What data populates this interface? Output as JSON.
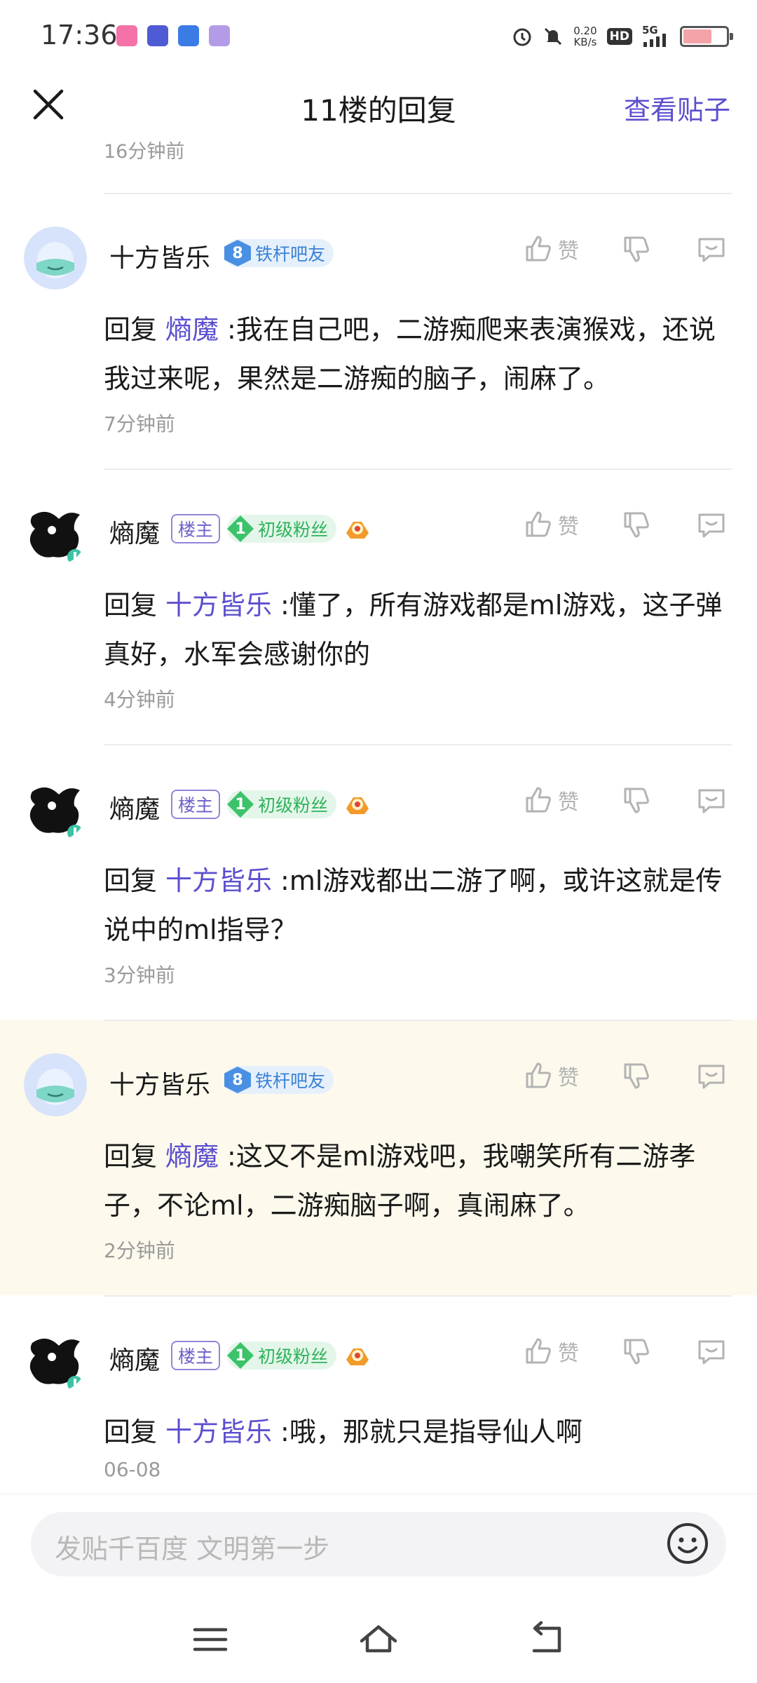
{
  "status_bar": {
    "time": "17:36",
    "net_speed_value": "0.20",
    "net_speed_unit": "KB/s",
    "hd": "HD",
    "signal": "5G",
    "icons": [
      "bilibili-app-icon",
      "tieba-app-icon",
      "tool-app-icon",
      "avatar-app-icon",
      "alarm-icon",
      "mute-icon",
      "signal-icon",
      "battery-icon"
    ]
  },
  "header": {
    "title": "11楼的回复",
    "view_post": "查看贴子"
  },
  "prev_reply_time": "16分钟前",
  "like_label": "赞",
  "reply_prefix": "回复",
  "replies": [
    {
      "user": "十方皆乐",
      "level": "8",
      "level_title": "铁杆吧友",
      "target": "熵魔",
      "text": ":我在自己吧，二游痴爬来表演猴戏，还说我过来呢，果然是二游痴的脑子，闹麻了。",
      "time": "7分钟前"
    },
    {
      "user": "熵魔",
      "owner_tag": "楼主",
      "level": "1",
      "level_title": "初级粉丝",
      "target": "十方皆乐",
      "text": ":懂了，所有游戏都是ml游戏，这子弹真好，水军会感谢你的",
      "time": "4分钟前"
    },
    {
      "user": "熵魔",
      "owner_tag": "楼主",
      "level": "1",
      "level_title": "初级粉丝",
      "target": "十方皆乐",
      "text": ":ml游戏都出二游了啊，或许这就是传说中的ml指导？",
      "time": "3分钟前"
    },
    {
      "user": "十方皆乐",
      "level": "8",
      "level_title": "铁杆吧友",
      "target": "熵魔",
      "text": ":这又不是ml游戏吧，我嘲笑所有二游孝子，不论ml，二游痴脑子啊，真闹麻了。",
      "time": "2分钟前"
    },
    {
      "user": "熵魔",
      "owner_tag": "楼主",
      "level": "1",
      "level_title": "初级粉丝",
      "target": "十方皆乐",
      "text": ":哦，那就只是指导仙人啊",
      "time": "06-08"
    }
  ],
  "input": {
    "placeholder": "发贴千百度 文明第一步"
  },
  "colors": {
    "accent": "#5b4fcf",
    "highlight_bg": "#fdf9ec",
    "meta_gray": "#9a9a9a"
  }
}
